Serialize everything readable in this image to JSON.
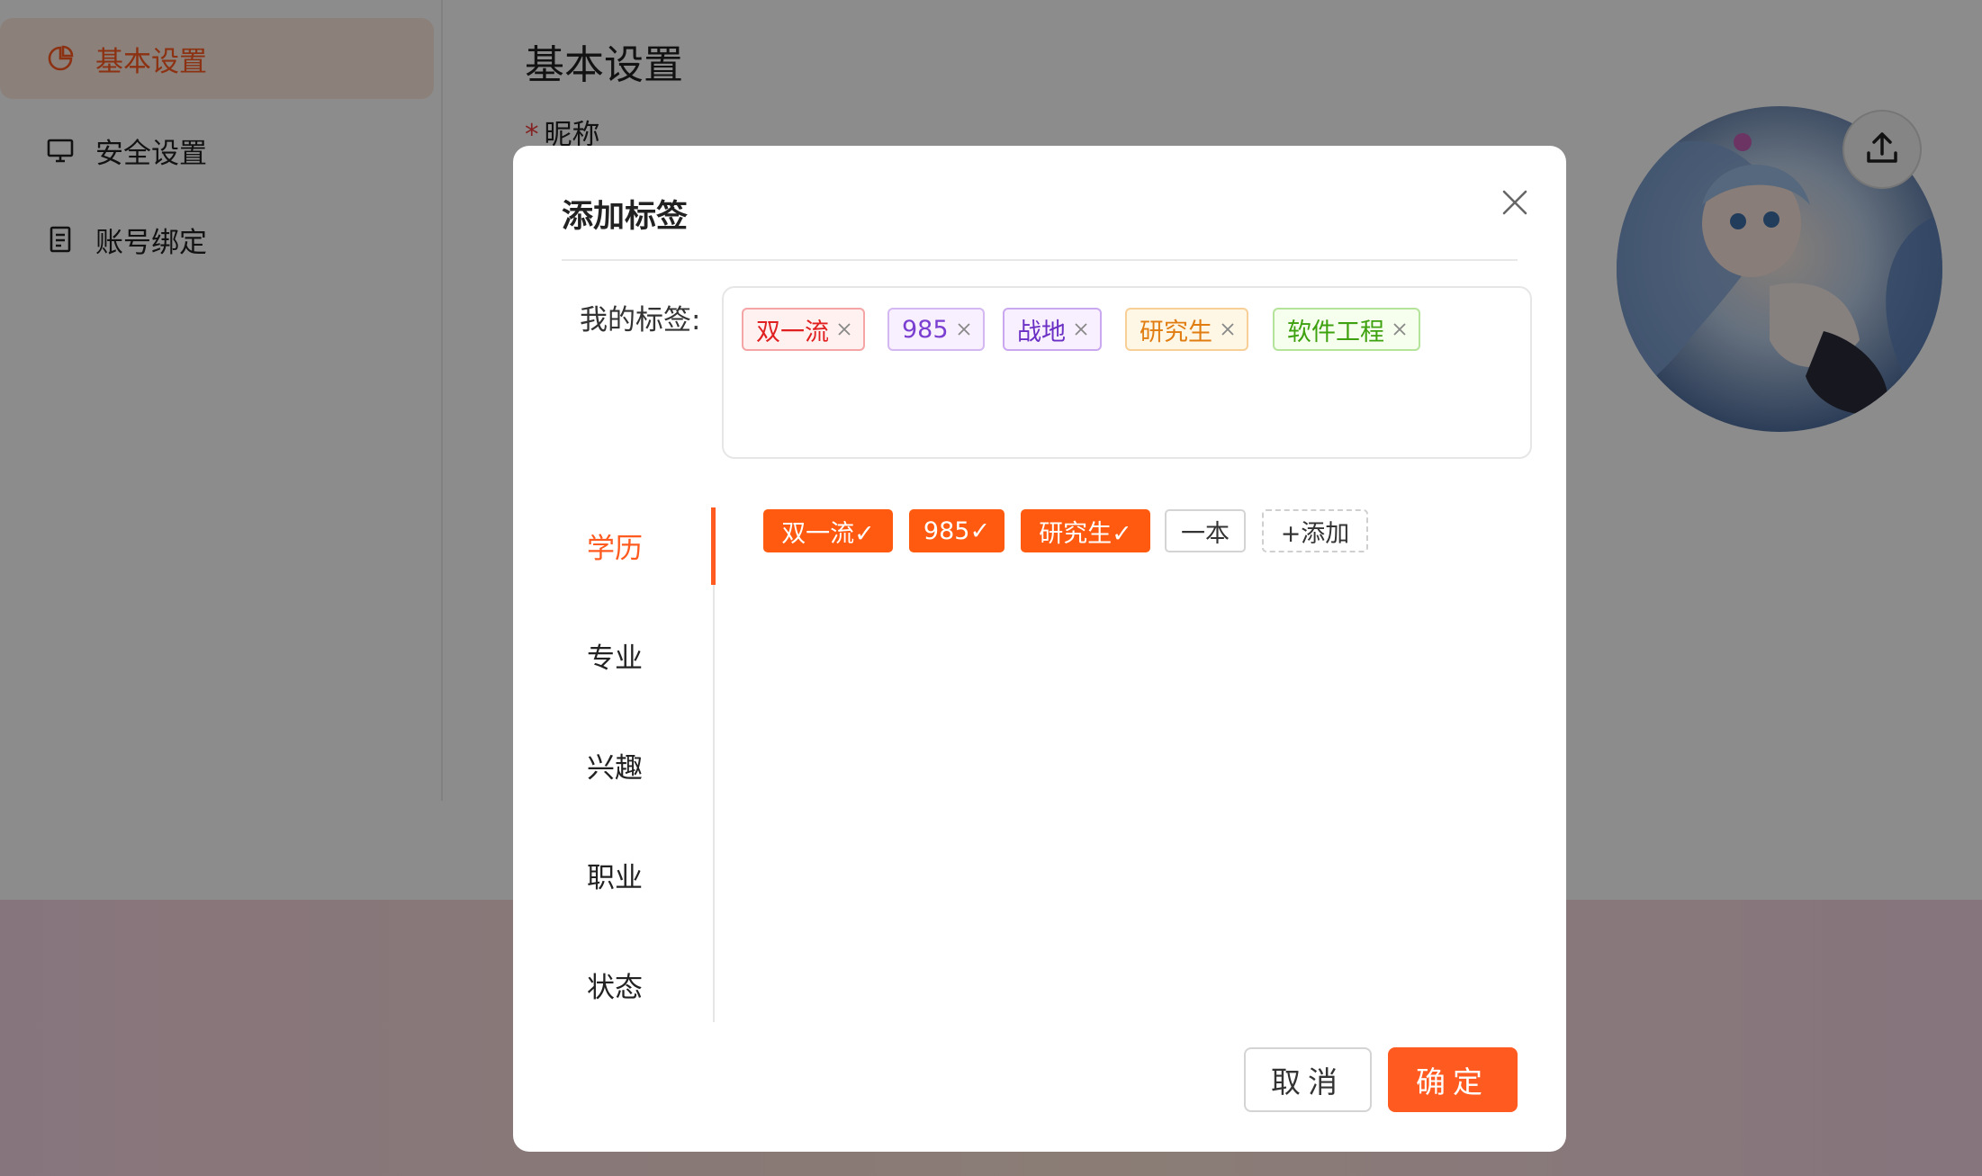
{
  "sidebar": {
    "items": [
      {
        "label": "基本设置",
        "icon": "pie-chart-icon",
        "active": true
      },
      {
        "label": "安全设置",
        "icon": "monitor-icon",
        "active": false
      },
      {
        "label": "账号绑定",
        "icon": "document-icon",
        "active": false
      }
    ]
  },
  "content": {
    "title": "基本设置",
    "nickname_required_mark": "*",
    "nickname_label": "昵称",
    "upload_icon": "upload-icon"
  },
  "modal": {
    "title": "添加标签",
    "close_icon": "close-icon",
    "my_tags_label": "我的标签:",
    "my_tags": [
      {
        "label": "双一流",
        "color": "#e02020",
        "border": "#f5a5a5",
        "bg": "#fff1f0"
      },
      {
        "label": "985",
        "color": "#7a3fd1",
        "border": "#d3b8f2",
        "bg": "#f9f0ff"
      },
      {
        "label": "战地",
        "color": "#6a2fc4",
        "border": "#caa8f0",
        "bg": "#f9f0ff"
      },
      {
        "label": "研究生",
        "color": "#e07c10",
        "border": "#f7cf97",
        "bg": "#fff7e6"
      },
      {
        "label": "软件工程",
        "color": "#3ea10f",
        "border": "#b4e39a",
        "bg": "#f6ffed"
      }
    ],
    "categories": [
      {
        "label": "学历",
        "active": true
      },
      {
        "label": "专业",
        "active": false
      },
      {
        "label": "兴趣",
        "active": false
      },
      {
        "label": "职业",
        "active": false
      },
      {
        "label": "状态",
        "active": false
      }
    ],
    "options": [
      {
        "label": "双一流✓",
        "selected": true
      },
      {
        "label": "985✓",
        "selected": true
      },
      {
        "label": "研究生✓",
        "selected": true
      },
      {
        "label": "一本",
        "selected": false
      }
    ],
    "add_label": "+添加",
    "cancel_label": "取消",
    "ok_label": "确定"
  },
  "colors": {
    "accent": "#ff5a1f",
    "overlay": "rgba(0,0,0,0.45)"
  }
}
